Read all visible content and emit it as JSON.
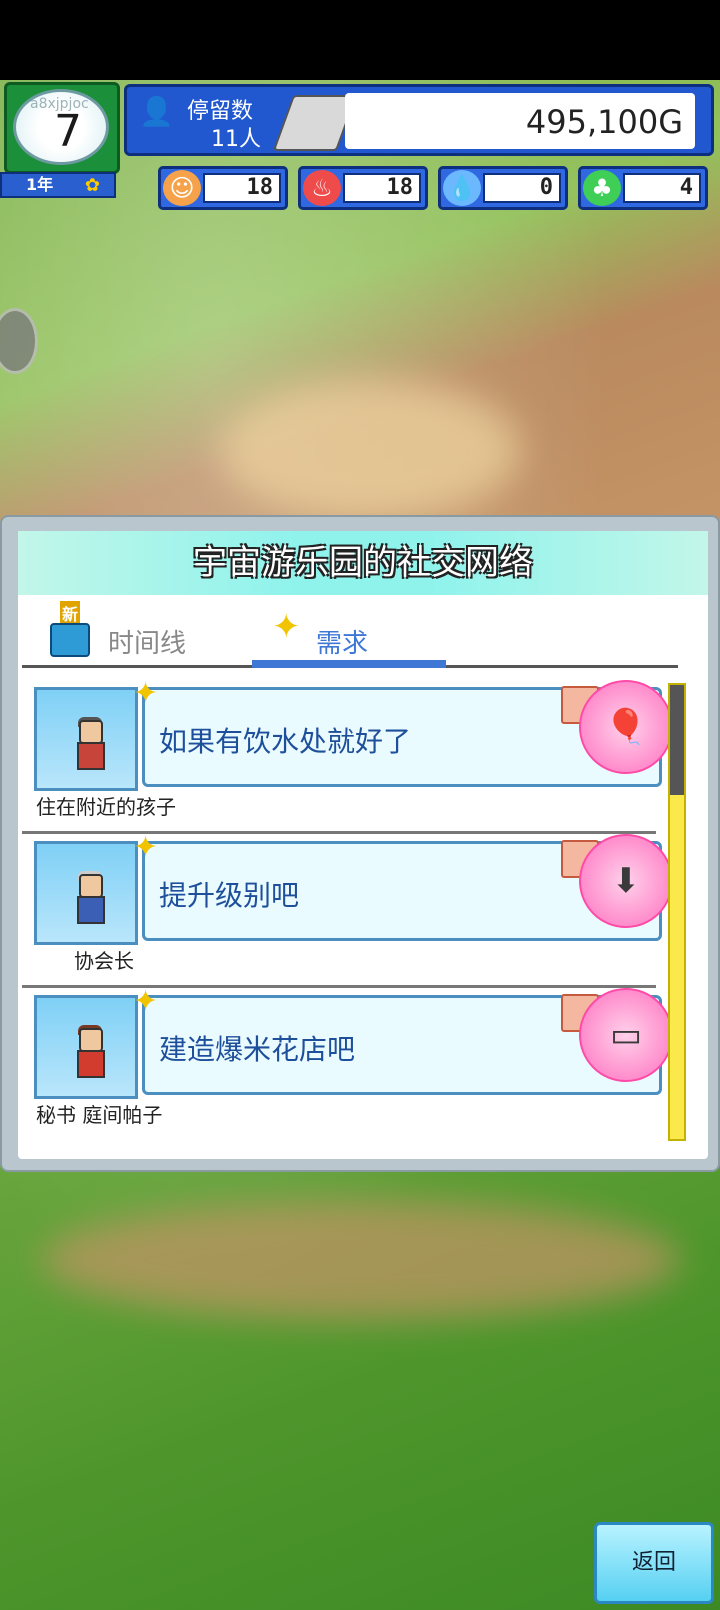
{
  "clock": {
    "overlay_text": "a8xjpjoc",
    "hour": "7"
  },
  "date": {
    "year_label": "1年"
  },
  "header": {
    "visitors_label": "停留数",
    "visitors_count": "11人",
    "money": "495,100G"
  },
  "stats": [
    {
      "icon": "happy-icon",
      "value": "18",
      "color": "#f6a24a"
    },
    {
      "icon": "fire-icon",
      "value": "18",
      "color": "#ef4b4b"
    },
    {
      "icon": "water-icon",
      "value": "0",
      "color": "#6bb8ff"
    },
    {
      "icon": "leaf-icon",
      "value": "4",
      "color": "#3fcf56"
    }
  ],
  "panel": {
    "title": "宇宙游乐园的社交网络",
    "tabs": {
      "timeline": {
        "label": "时间线",
        "badge": "新"
      },
      "needs": {
        "label": "需求"
      }
    },
    "items": [
      {
        "text": "如果有饮水处就好了",
        "person": "住在附近的孩子",
        "reward_icon": "balloon-icon"
      },
      {
        "text": "提升级别吧",
        "person": "协会长",
        "reward_icon": "money-down-icon"
      },
      {
        "text": "建造爆米花店吧",
        "person": "秘书 庭间帕子",
        "reward_icon": "money-icon"
      }
    ]
  },
  "footer": {
    "back_label": "返回"
  }
}
